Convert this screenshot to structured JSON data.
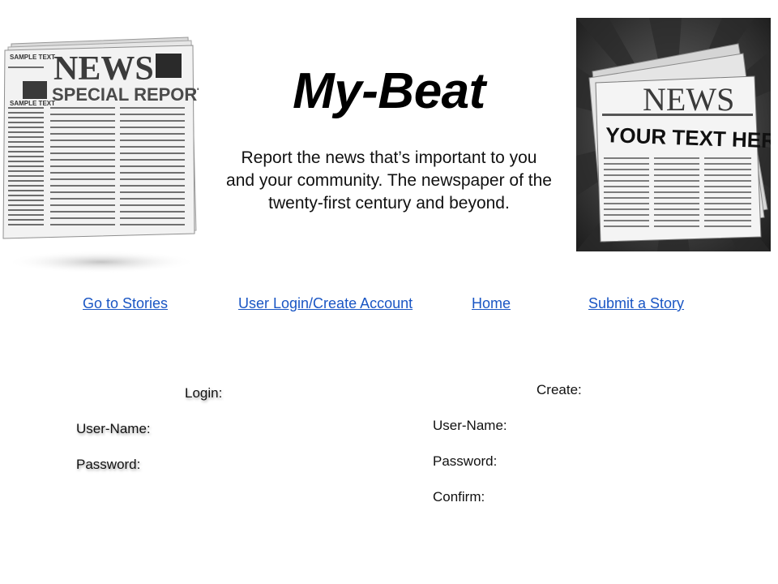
{
  "header": {
    "title": "My-Beat",
    "tagline_lines": [
      "Report the news that’s important to you",
      "and your community. The newspaper of the",
      "twenty-first century and beyond."
    ]
  },
  "left_image": {
    "icon": "newspaper-special-report-icon",
    "sample_text_1": "SAMPLE TEXT",
    "headline": "NEWS",
    "subheadline": "SPECIAL REPORT",
    "sample_text_2": "SAMPLE TEXT"
  },
  "right_image": {
    "icon": "newspaper-your-text-here-icon",
    "headline": "NEWS",
    "subheadline": "YOUR TEXT HERE!"
  },
  "nav": {
    "links": [
      {
        "label": "Go to Stories"
      },
      {
        "label": "User Login/Create Account"
      },
      {
        "label": "Home"
      },
      {
        "label": "Submit a Story"
      }
    ]
  },
  "login": {
    "heading": "Login:",
    "username_label": "User-Name:",
    "password_label": "Password:"
  },
  "create": {
    "heading": "Create:",
    "username_label": "User-Name:",
    "password_label": "Password:",
    "confirm_label": "Confirm:"
  },
  "colors": {
    "link": "#1a56c4",
    "text": "#111111",
    "background": "#ffffff"
  }
}
